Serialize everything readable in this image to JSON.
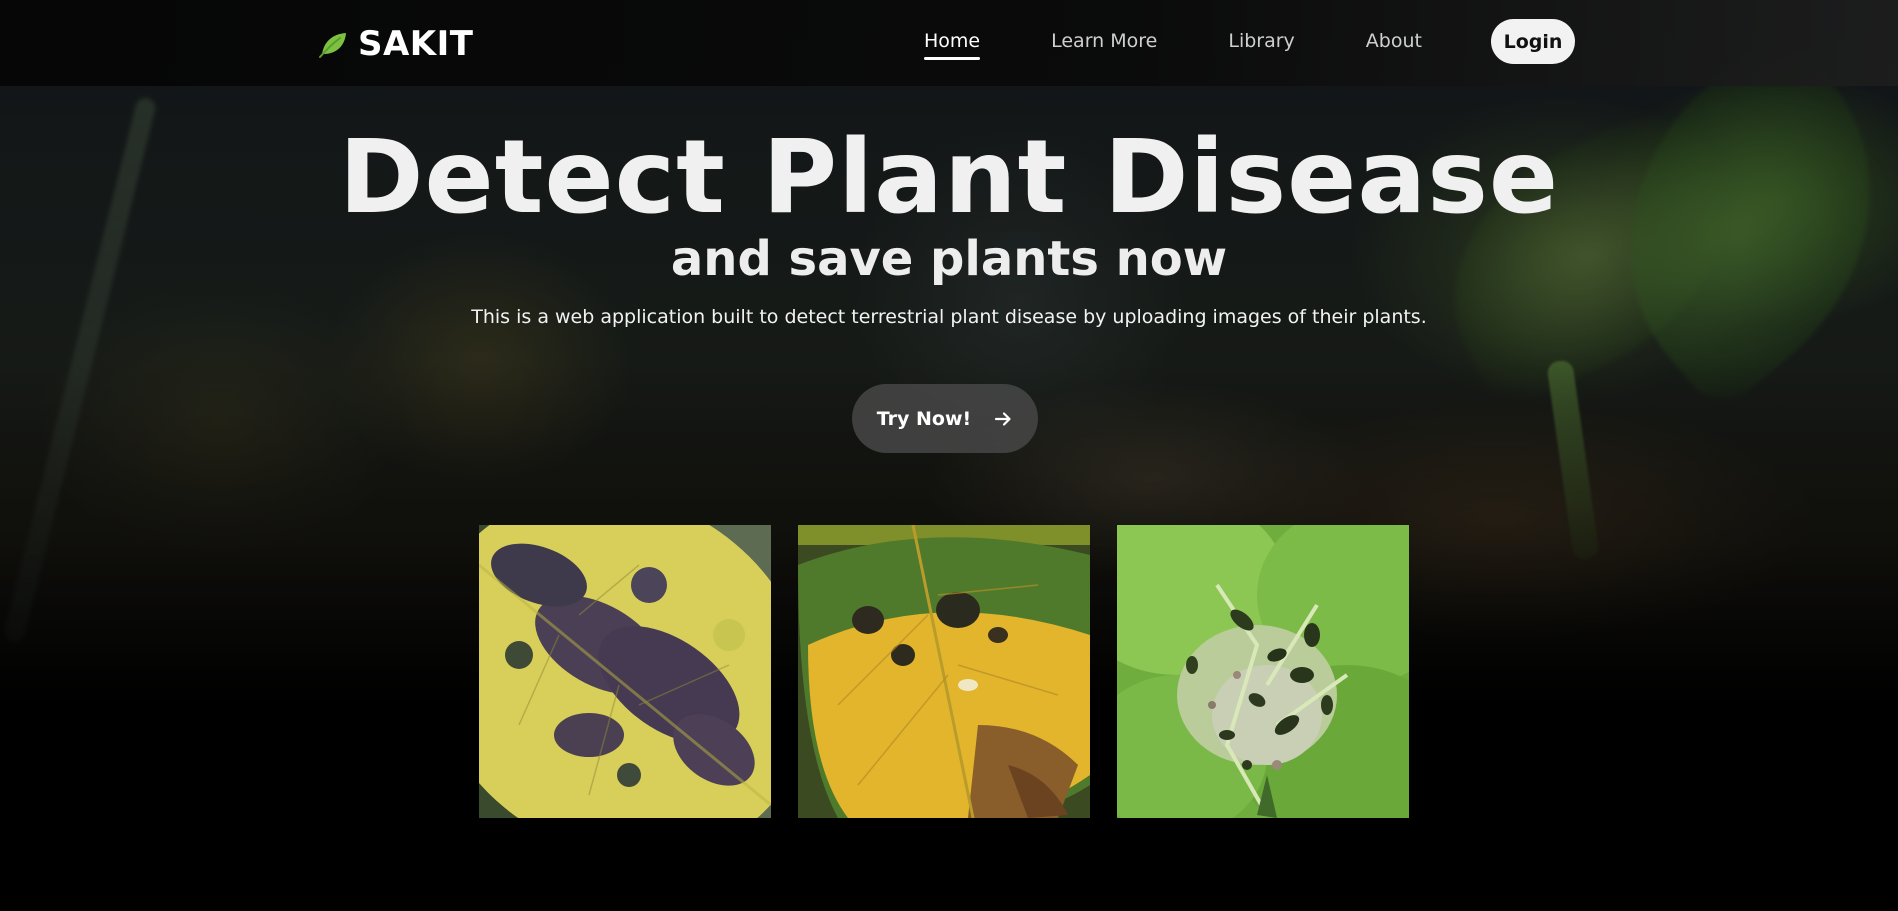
{
  "nav": {
    "brand_name": "SAKIT",
    "brand_icon": "leaf-icon",
    "links": [
      {
        "label": "Home",
        "active": true
      },
      {
        "label": "Learn More",
        "active": false
      },
      {
        "label": "Library",
        "active": false
      },
      {
        "label": "About",
        "active": false
      }
    ],
    "login_label": "Login"
  },
  "hero": {
    "title": "Detect Plant Disease",
    "subtitle": "and save plants now",
    "description": "This is a web application built to detect terrestrial plant disease by uploading images of their plants.",
    "cta_label": "Try Now!",
    "cta_icon": "arrow-right-icon"
  },
  "gallery": [
    {
      "image": "leaf-black-spot-yellow"
    },
    {
      "image": "leaf-yellowing-dark-spots"
    },
    {
      "image": "leaf-holes-green"
    }
  ],
  "colors": {
    "brand_leaf": "#7cc242",
    "login_bg": "#f2f2f2",
    "cta_bg": "#464646",
    "page_bg": "#000000"
  }
}
